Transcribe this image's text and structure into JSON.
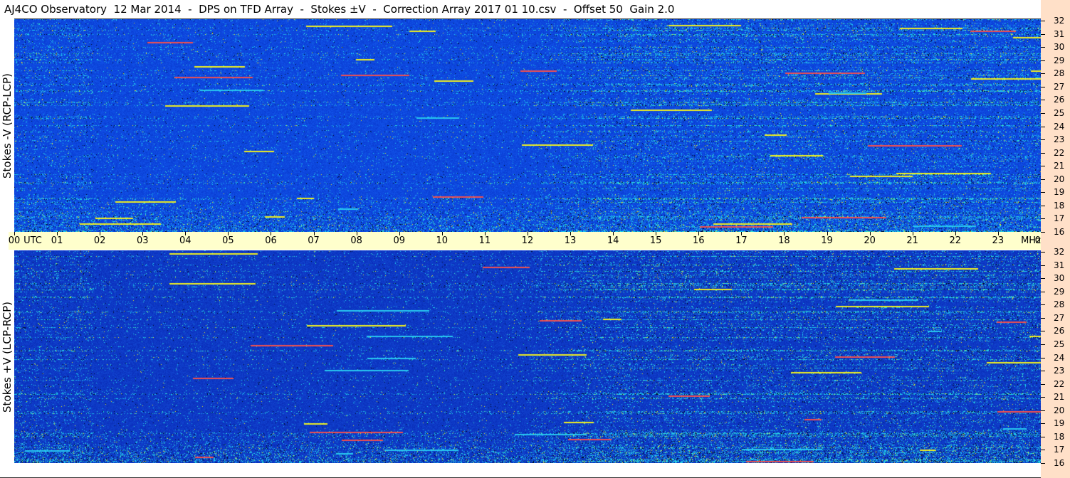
{
  "title": "AJ4CO Observatory  12 Mar 2014  -  DPS on TFD Array  -  Stokes ±V  -  Correction Array 2017 01 10.csv  -  Offset 50  Gain 2.0",
  "panels": {
    "top_label": "Stokes -V (RCP-LCP)",
    "bottom_label": "Stokes +V (LCP-RCP)"
  },
  "time_axis": {
    "labels": [
      "00",
      "UTC",
      "01",
      "02",
      "03",
      "04",
      "05",
      "06",
      "07",
      "08",
      "09",
      "10",
      "11",
      "12",
      "13",
      "14",
      "15",
      "16",
      "17",
      "18",
      "19",
      "20",
      "21",
      "22",
      "23",
      "00",
      "MHz"
    ]
  },
  "freq_axis": {
    "labels": [
      "32",
      "31",
      "30",
      "29",
      "28",
      "27",
      "26",
      "25",
      "24",
      "23",
      "22",
      "21",
      "20",
      "19",
      "18",
      "17",
      "16"
    ]
  },
  "colors": {
    "background_blue": "#0a3fd0",
    "time_axis_bg": "#ffffcc",
    "freq_strip_bg": "#ffe0c8",
    "stripe_cyan": "#28c8f0",
    "stripe_yellow": "#f0f020",
    "stripe_red": "#f03030",
    "stripe_dark": "#000820"
  }
}
